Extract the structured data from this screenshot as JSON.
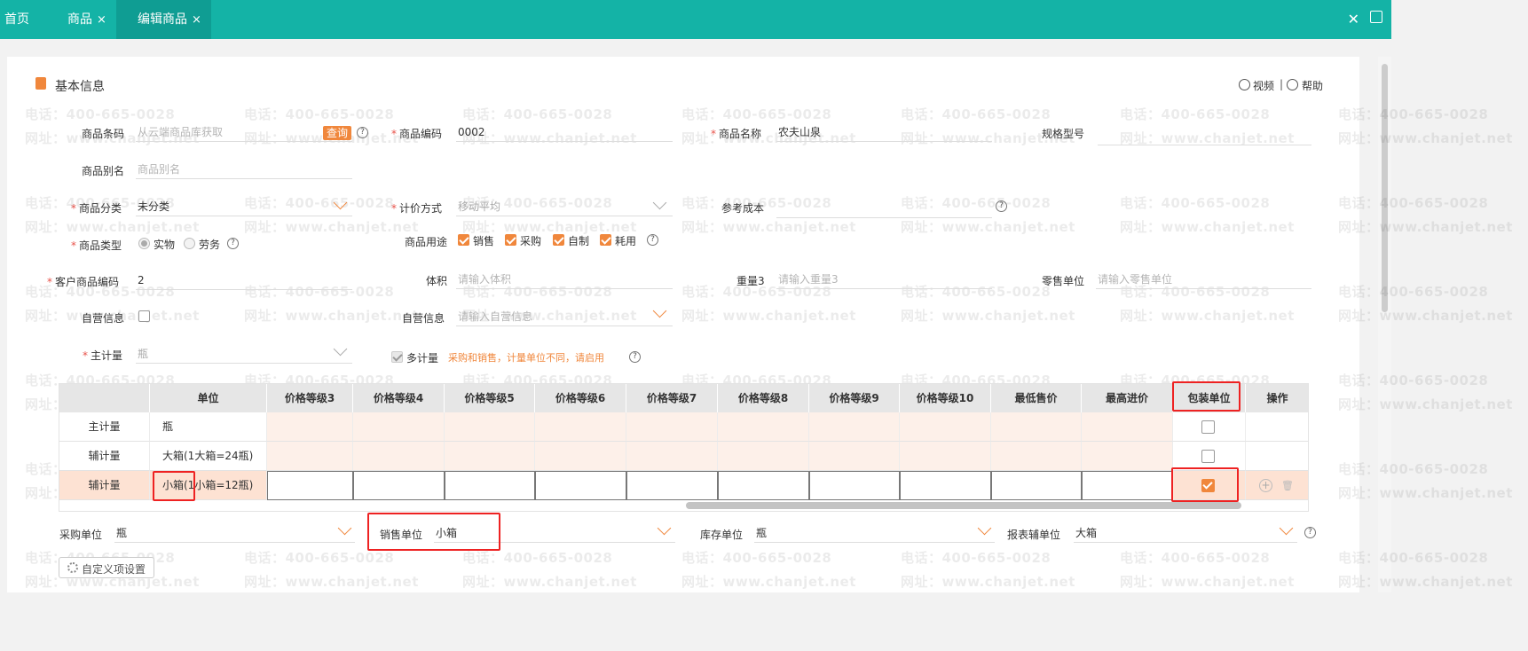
{
  "tabs": [
    {
      "label": "首页"
    },
    {
      "label": "商品",
      "close": "×"
    },
    {
      "label": "编辑商品",
      "close": "×"
    }
  ],
  "watermark": {
    "phone": "电话：400-665-0028",
    "site": "网址：www.chanjet.net"
  },
  "section": {
    "title": "基本信息",
    "video": "视频",
    "sep": "|",
    "help": "帮助"
  },
  "fields": {
    "barcode": {
      "label": "商品条码",
      "placeholder": "从云端商品库获取",
      "query": "查询"
    },
    "code": {
      "label": "商品编码",
      "value": "0002"
    },
    "name": {
      "label": "商品名称",
      "value": "农夫山泉"
    },
    "spec": {
      "label": "规格型号",
      "value": ""
    },
    "alias": {
      "label": "商品别名",
      "placeholder": "商品别名"
    },
    "category": {
      "label": "商品分类",
      "value": "未分类"
    },
    "pricing": {
      "label": "计价方式",
      "value": "移动平均"
    },
    "refcost": {
      "label": "参考成本",
      "value": ""
    },
    "type": {
      "label": "商品类型",
      "options": [
        "实物",
        "劳务"
      ],
      "selected": "实物"
    },
    "usage": {
      "label": "商品用途",
      "options": [
        "销售",
        "采购",
        "自制",
        "耗用"
      ]
    },
    "custcode": {
      "label": "客户商品编码",
      "value": "2"
    },
    "volume": {
      "label": "体积",
      "placeholder": "请输入体积"
    },
    "weight": {
      "label": "重量3",
      "placeholder": "请输入重量3"
    },
    "retailunit": {
      "label": "零售单位",
      "placeholder": "请输入零售单位"
    },
    "selfop": {
      "label": "自营信息"
    },
    "selfop2": {
      "label": "自营信息",
      "placeholder": "请输入自营信息"
    },
    "mainunit": {
      "label": "主计量",
      "value": "瓶"
    },
    "multi": {
      "label": "多计量",
      "warning": "采购和销售，计量单位不同，请启用"
    }
  },
  "grid": {
    "headers": [
      "",
      "单位",
      "价格等级3",
      "价格等级4",
      "价格等级5",
      "价格等级6",
      "价格等级7",
      "价格等级8",
      "价格等级9",
      "价格等级10",
      "最低售价",
      "最高进价",
      "包装单位",
      "操作"
    ],
    "rows": [
      {
        "type": "主计量",
        "unit": "瓶",
        "pack": false
      },
      {
        "type": "辅计量",
        "unit": "大箱(1大箱=24瓶)",
        "pack": false
      },
      {
        "type": "辅计量",
        "unit": "小箱(1小箱=12瓶)",
        "pack": true
      }
    ],
    "ops": {
      "add": "+",
      "del": "🗑"
    }
  },
  "bottom": {
    "purchase": {
      "label": "采购单位",
      "value": "瓶"
    },
    "sales": {
      "label": "销售单位",
      "value": "小箱"
    },
    "stock": {
      "label": "库存单位",
      "value": "瓶"
    },
    "report": {
      "label": "报表辅单位",
      "value": "大箱"
    }
  },
  "custom_btn": "自定义项设置",
  "colors": {
    "teal": "#14b3a6",
    "orange": "#f0873c",
    "red": "#e22222"
  }
}
